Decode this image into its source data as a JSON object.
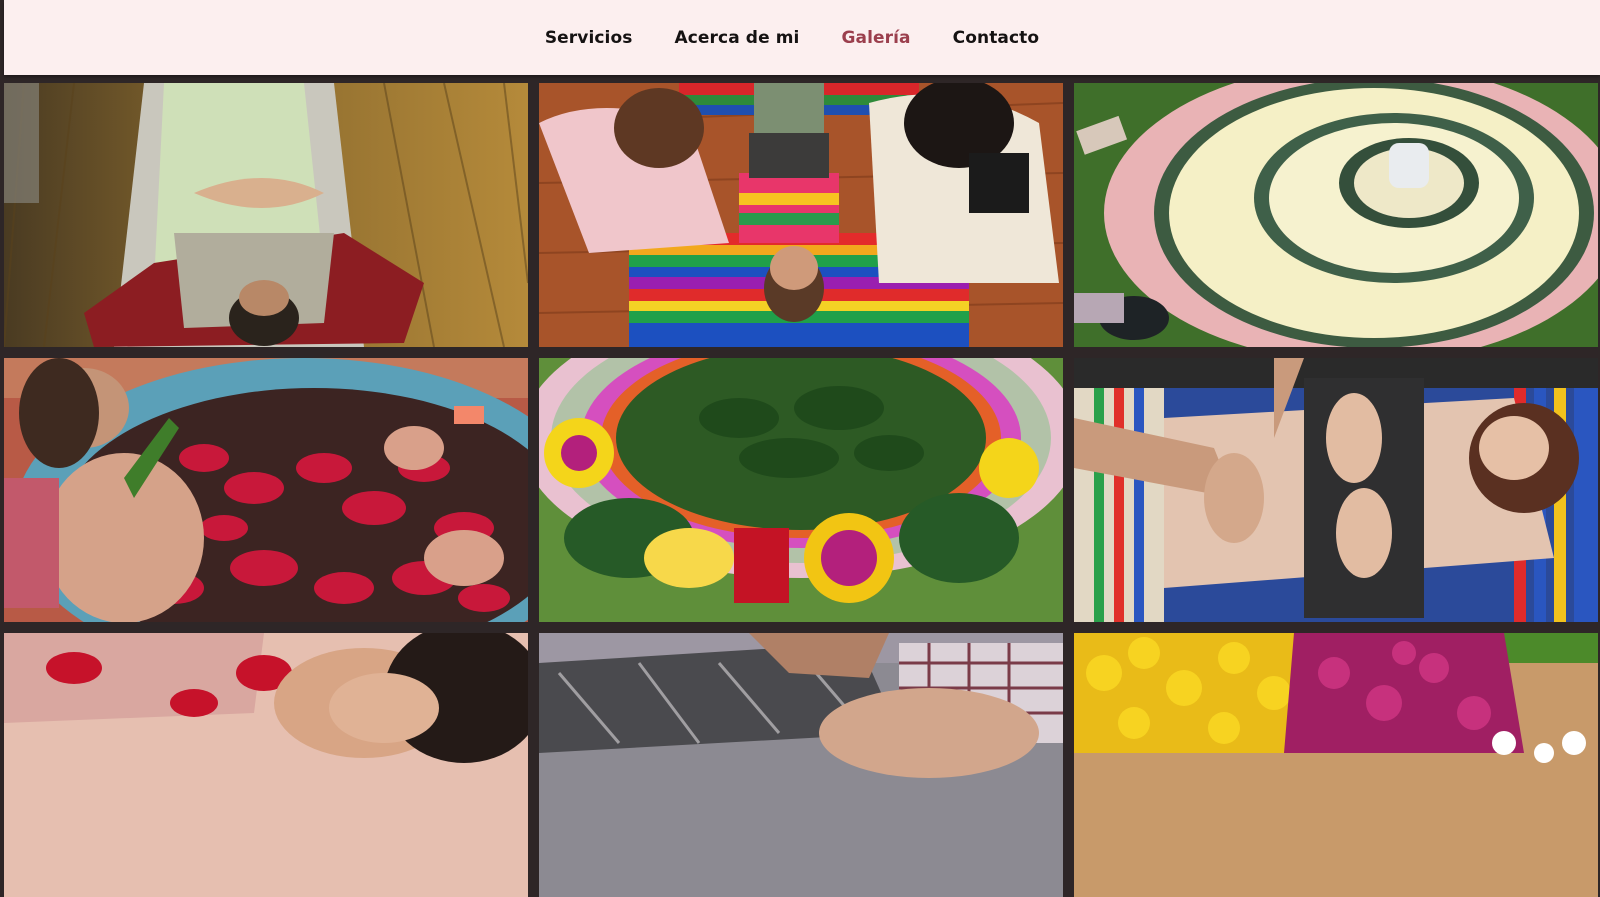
{
  "nav": {
    "items": [
      {
        "label": "Servicios",
        "active": false
      },
      {
        "label": "Acerca de mi",
        "active": false
      },
      {
        "label": "Galería",
        "active": true
      },
      {
        "label": "Contacto",
        "active": false
      }
    ],
    "accent_color": "#9b3f4d",
    "bar_color": "#fcefef"
  },
  "gallery": {
    "background_color": "#2e2627",
    "images": [
      {
        "subject": "woman-resting-on-wood-floor"
      },
      {
        "subject": "women-around-person-on-sarape"
      },
      {
        "subject": "petal-mandala-with-candle"
      },
      {
        "subject": "woman-in-rose-petal-bath"
      },
      {
        "subject": "flower-mandala-on-grass"
      },
      {
        "subject": "hands-on-abdomen-massage"
      },
      {
        "subject": "woman-in-water-with-petals"
      },
      {
        "subject": "person-wrapped-in-cloth"
      },
      {
        "subject": "yellow-and-purple-flowers-box"
      }
    ]
  }
}
